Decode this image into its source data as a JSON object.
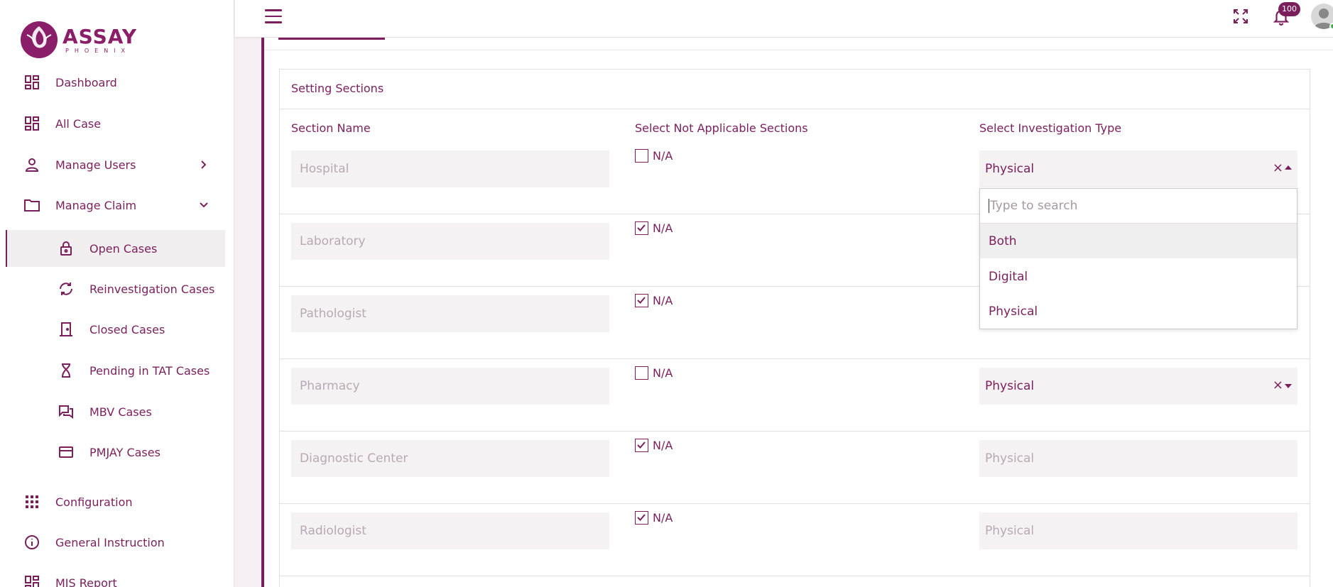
{
  "brand": {
    "name": "ASSAY",
    "tagline": "PHOENIX"
  },
  "sidebar": {
    "items": [
      {
        "label": "Dashboard"
      },
      {
        "label": "All Case"
      },
      {
        "label": "Manage Users"
      },
      {
        "label": "Manage Claim"
      },
      {
        "label": "Open Cases"
      },
      {
        "label": "Reinvestigation Cases"
      },
      {
        "label": "Closed Cases"
      },
      {
        "label": "Pending in TAT Cases"
      },
      {
        "label": "MBV Cases"
      },
      {
        "label": "PMJAY Cases"
      },
      {
        "label": "Configuration"
      },
      {
        "label": "General Instruction"
      },
      {
        "label": "MIS Report"
      }
    ]
  },
  "topbar": {
    "notifications": "100"
  },
  "card": {
    "title": "Setting Sections",
    "headers": {
      "section": "Section Name",
      "na": "Select Not Applicable Sections",
      "type": "Select Investigation Type"
    },
    "rows": [
      {
        "name": "Hospital",
        "na_label": "N/A",
        "checked": false,
        "type": "Physical"
      },
      {
        "name": "Laboratory",
        "na_label": "N/A",
        "checked": true,
        "type": ""
      },
      {
        "name": "Pathologist",
        "na_label": "N/A",
        "checked": true,
        "type": ""
      },
      {
        "name": "Pharmacy",
        "na_label": "N/A",
        "checked": false,
        "type": "Physical"
      },
      {
        "name": "Diagnostic Center",
        "na_label": "N/A",
        "checked": true,
        "type": "Physical"
      },
      {
        "name": "Radiologist",
        "na_label": "N/A",
        "checked": true,
        "type": "Physical"
      }
    ]
  },
  "dropdown": {
    "placeholder": "Type to search",
    "options": [
      {
        "label": "Both"
      },
      {
        "label": "Digital"
      },
      {
        "label": "Physical"
      }
    ]
  },
  "colors": {
    "brand": "#7a1f5c",
    "bg": "#f4f0f3"
  }
}
